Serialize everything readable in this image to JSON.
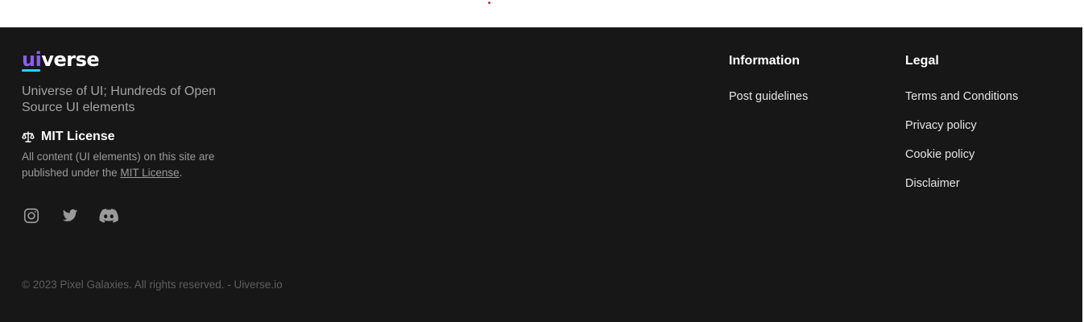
{
  "logo": {
    "accent_part": "ui",
    "rest_part": "verse",
    "accent_color": "#8b5cf6",
    "underline_color": "#22d3ee"
  },
  "tagline": "Universe of UI; Hundreds of Open Source UI elements",
  "license": {
    "icon": "scale-icon",
    "title": "MIT License",
    "text_before": "All content (UI elements) on this site are published under the ",
    "link_text": "MIT License",
    "text_after": "."
  },
  "socials": [
    {
      "icon": "instagram-icon"
    },
    {
      "icon": "twitter-icon"
    },
    {
      "icon": "discord-icon"
    }
  ],
  "copyright": "© 2023 Pixel Galaxies. All rights reserved. - Uiverse.io",
  "information": {
    "heading": "Information",
    "links": [
      "Post guidelines"
    ]
  },
  "legal": {
    "heading": "Legal",
    "links": [
      "Terms and Conditions",
      "Privacy policy",
      "Cookie policy",
      "Disclaimer"
    ]
  },
  "colors": {
    "footer_bg": "#171717",
    "top_dot": "#d9262c"
  }
}
